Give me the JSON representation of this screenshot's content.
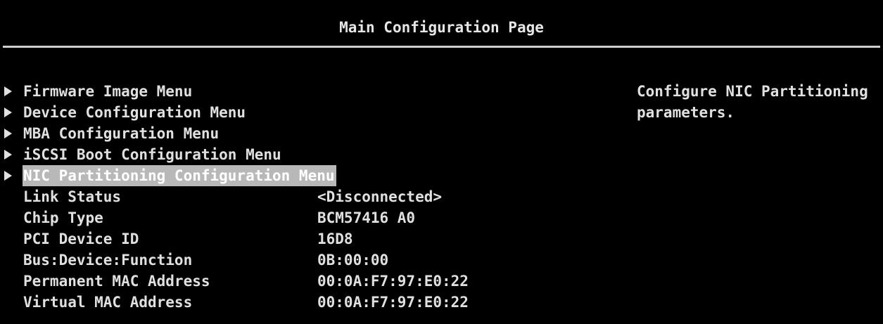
{
  "page": {
    "title": "Main Configuration Page"
  },
  "menu": {
    "items": [
      {
        "label": "Firmware Image Menu"
      },
      {
        "label": "Device Configuration Menu"
      },
      {
        "label": "MBA Configuration Menu"
      },
      {
        "label": "iSCSI Boot Configuration Menu"
      },
      {
        "label": "NIC Partitioning Configuration Menu",
        "selected": true
      }
    ]
  },
  "info": {
    "rows": [
      {
        "label": "Link Status",
        "value": "<Disconnected>"
      },
      {
        "label": "Chip Type",
        "value": "BCM57416 A0"
      },
      {
        "label": "PCI Device ID",
        "value": "16D8"
      },
      {
        "label": "Bus:Device:Function",
        "value": "0B:00:00"
      },
      {
        "label": "Permanent MAC Address",
        "value": "00:0A:F7:97:E0:22"
      },
      {
        "label": "Virtual MAC Address",
        "value": "00:0A:F7:97:E0:22"
      }
    ]
  },
  "help": {
    "text": "Configure NIC Partitioning\nparameters."
  },
  "colors": {
    "background": "#000000",
    "text": "#e0e0e0",
    "highlight": "#b8b8b8",
    "rule": "#cfcfcf"
  }
}
